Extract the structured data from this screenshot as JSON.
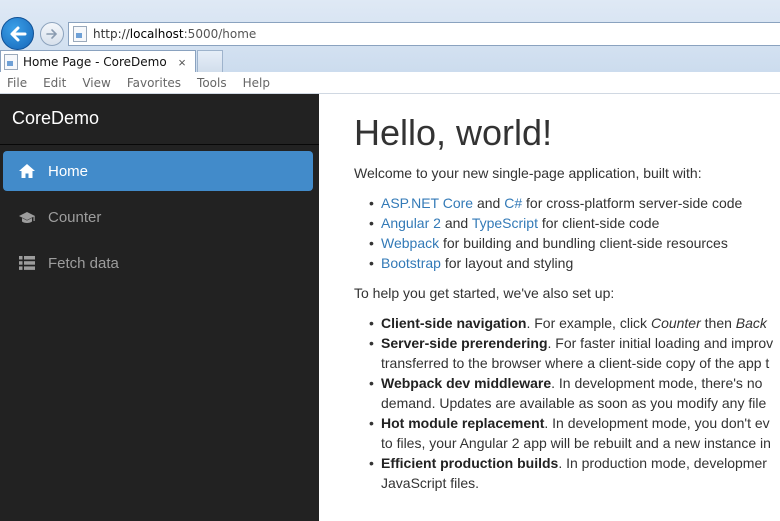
{
  "browser": {
    "url_prefix": "http://",
    "url_host": "localhost",
    "url_rest": ":5000/home",
    "tab_title": "Home Page - CoreDemo",
    "tab_close": "×",
    "menu": [
      "File",
      "Edit",
      "View",
      "Favorites",
      "Tools",
      "Help"
    ]
  },
  "sidebar": {
    "brand": "CoreDemo",
    "items": [
      {
        "label": "Home",
        "icon": "home-icon",
        "active": true
      },
      {
        "label": "Counter",
        "icon": "graduation-cap-icon",
        "active": false
      },
      {
        "label": "Fetch data",
        "icon": "list-icon",
        "active": false
      }
    ]
  },
  "main": {
    "title": "Hello, world!",
    "intro": "Welcome to your new single-page application, built with:",
    "built_with": [
      {
        "link1": "ASP.NET Core",
        "t1": " and ",
        "link2": "C#",
        "t2": " for cross-platform server-side code"
      },
      {
        "link1": "Angular 2",
        "t1": " and ",
        "link2": "TypeScript",
        "t2": " for client-side code"
      },
      {
        "link1": "Webpack",
        "t1": " for building and bundling client-side resources",
        "link2": "",
        "t2": ""
      },
      {
        "link1": "Bootstrap",
        "t1": " for layout and styling",
        "link2": "",
        "t2": ""
      }
    ],
    "help_intro": "To help you get started, we've also set up:",
    "features": [
      {
        "bold": "Client-side navigation",
        "text": ". For example, click ",
        "em1": "Counter",
        "text2": " then ",
        "em2": "Back",
        "cont": ""
      },
      {
        "bold": "Server-side prerendering",
        "text": ". For faster initial loading and improv",
        "em1": "",
        "text2": "",
        "em2": "",
        "cont": "transferred to the browser where a client-side copy of the app t"
      },
      {
        "bold": "Webpack dev middleware",
        "text": ". In development mode, there's no",
        "em1": "",
        "text2": "",
        "em2": "",
        "cont": "demand. Updates are available as soon as you modify any file"
      },
      {
        "bold": "Hot module replacement",
        "text": ". In development mode, you don't ev",
        "em1": "",
        "text2": "",
        "em2": "",
        "cont": "to files, your Angular 2 app will be rebuilt and a new instance in"
      },
      {
        "bold": "Efficient production builds",
        "text": ". In production mode, developmer",
        "em1": "",
        "text2": "",
        "em2": "",
        "cont": "JavaScript files."
      }
    ]
  },
  "colors": {
    "sidebar_bg": "#222222",
    "active_nav": "#428bca",
    "link": "#337ab7"
  }
}
